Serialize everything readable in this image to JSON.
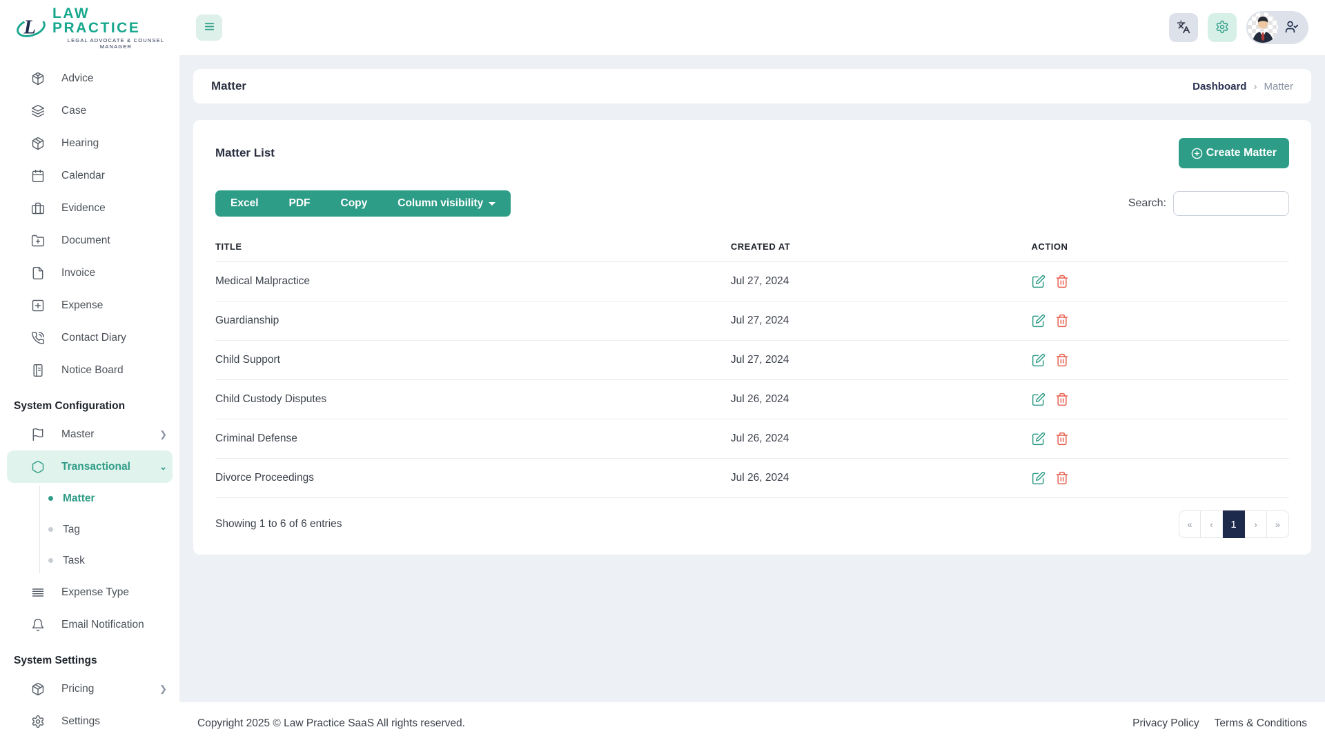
{
  "brand": {
    "name": "LAW PRACTICE",
    "tagline": "LEGAL ADVOCATE & COUNSEL MANAGER"
  },
  "sidebar": {
    "items_main": [
      "Advice",
      "Case",
      "Hearing",
      "Calendar",
      "Evidence",
      "Document",
      "Invoice",
      "Expense",
      "Contact Diary",
      "Notice Board"
    ],
    "section_config": "System Configuration",
    "master_label": "Master",
    "transactional_label": "Transactional",
    "submenu": [
      "Matter",
      "Tag",
      "Task"
    ],
    "expense_type_label": "Expense Type",
    "email_notification_label": "Email Notification",
    "section_settings": "System Settings",
    "pricing_label": "Pricing",
    "settings_label": "Settings"
  },
  "breadcrumb": {
    "page_title": "Matter",
    "root": "Dashboard",
    "separator": "›",
    "current": "Matter"
  },
  "matter_card": {
    "title": "Matter List",
    "create_button_label": "Create Matter",
    "export_excel": "Excel",
    "export_pdf": "PDF",
    "export_copy": "Copy",
    "column_visibility_label": "Column visibility",
    "search_label": "Search:",
    "search_value": ""
  },
  "table": {
    "headers": [
      "TITLE",
      "CREATED AT",
      "ACTION"
    ],
    "rows": [
      {
        "title": "Medical Malpractice",
        "created_at": "Jul 27, 2024"
      },
      {
        "title": "Guardianship",
        "created_at": "Jul 27, 2024"
      },
      {
        "title": "Child Support",
        "created_at": "Jul 27, 2024"
      },
      {
        "title": "Child Custody Disputes",
        "created_at": "Jul 26, 2024"
      },
      {
        "title": "Criminal Defense",
        "created_at": "Jul 26, 2024"
      },
      {
        "title": "Divorce Proceedings",
        "created_at": "Jul 26, 2024"
      }
    ],
    "summary": "Showing 1 to 6 of 6 entries"
  },
  "pagination": {
    "first": "«",
    "prev": "‹",
    "page": "1",
    "next": "›",
    "last": "»"
  },
  "footer": {
    "copyright": "Copyright 2025 © Law Practice SaaS All rights reserved.",
    "privacy": "Privacy Policy",
    "terms": "Terms & Conditions"
  },
  "colors": {
    "accent": "#2e9d87",
    "accent_soft": "#e1f3ed",
    "navy": "#1e2a4c",
    "danger": "#e95f4f",
    "page_bg": "#edf0f4"
  }
}
